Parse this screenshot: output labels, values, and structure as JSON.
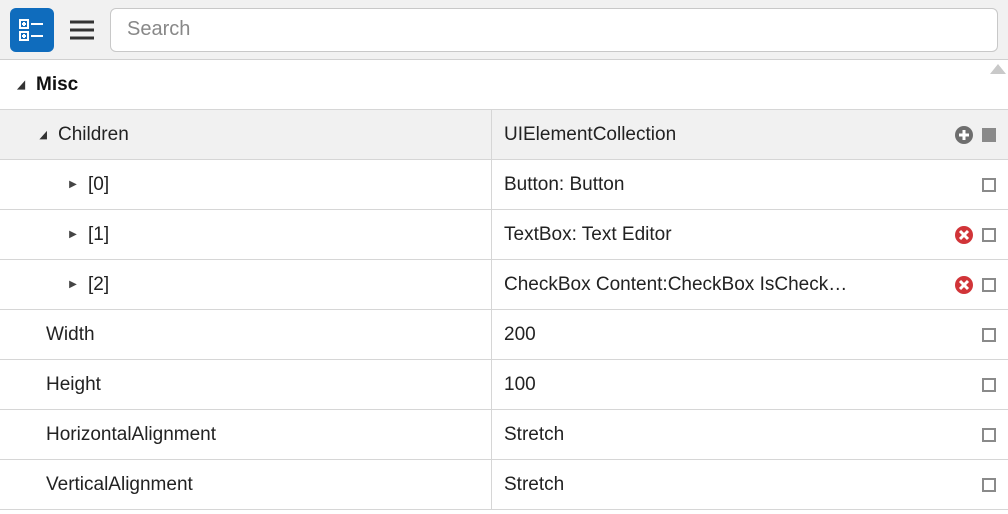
{
  "search": {
    "placeholder": "Search"
  },
  "category": {
    "label": "Misc"
  },
  "children_row": {
    "name": "Children",
    "value": "UIElementCollection"
  },
  "child_items": [
    {
      "index": "[0]",
      "value": "Button: Button",
      "has_delete": false
    },
    {
      "index": "[1]",
      "value": "TextBox: Text Editor",
      "has_delete": true
    },
    {
      "index": "[2]",
      "value": "CheckBox  Content:CheckBox  IsCheck…",
      "has_delete": true
    }
  ],
  "props": [
    {
      "name": "Width",
      "value": "200"
    },
    {
      "name": "Height",
      "value": "100"
    },
    {
      "name": "HorizontalAlignment",
      "value": "Stretch"
    },
    {
      "name": "VerticalAlignment",
      "value": "Stretch"
    }
  ]
}
